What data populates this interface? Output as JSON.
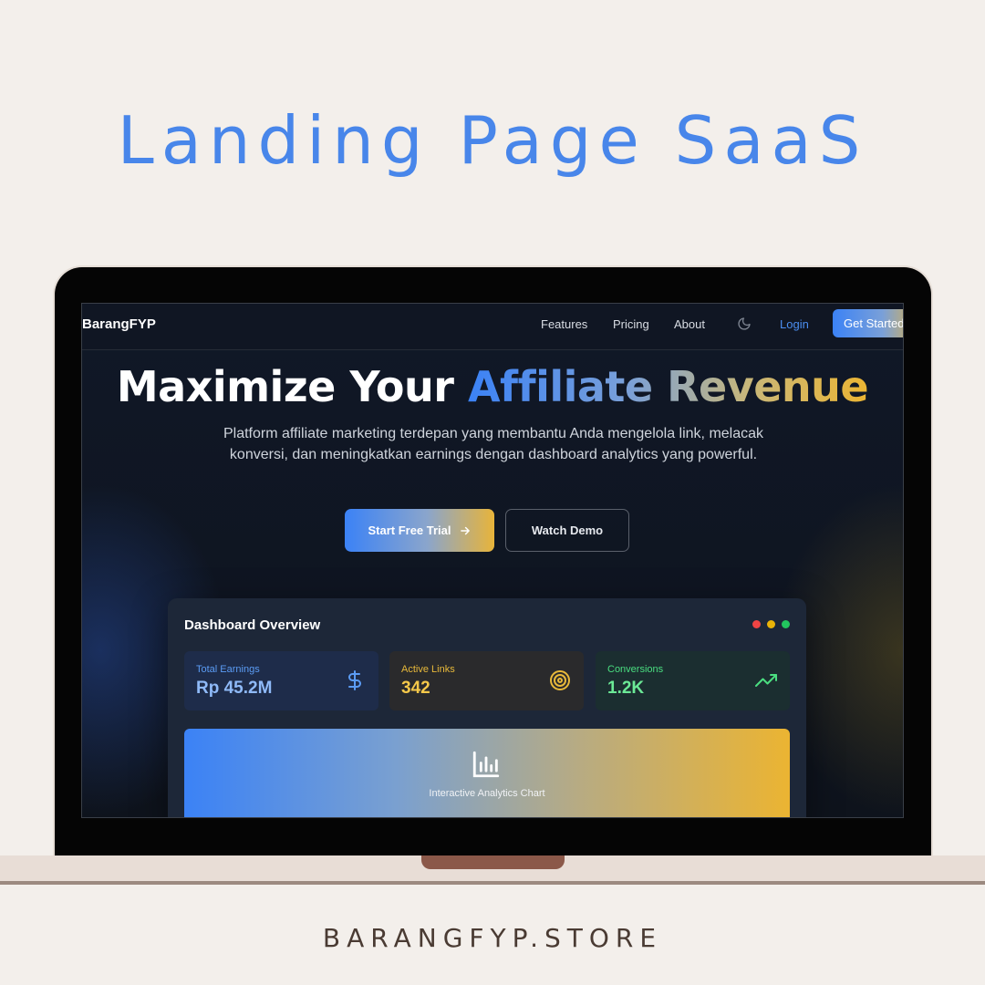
{
  "poster": {
    "title": "Landing Page SaaS",
    "footer": "BARANGFYP.STORE"
  },
  "navbar": {
    "brand": "BarangFYP",
    "links": [
      "Features",
      "Pricing",
      "About"
    ],
    "theme_icon": "moon-icon",
    "login": "Login",
    "cta": "Get Started"
  },
  "hero": {
    "title_plain": "Maximize Your ",
    "title_highlight": "Affiliate Revenue",
    "subtitle": "Platform affiliate marketing terdepan yang membantu Anda mengelola link, melacak konversi, dan meningkatkan earnings dengan dashboard analytics yang powerful.",
    "primary_button": "Start Free Trial",
    "primary_button_icon": "arrow-right-icon",
    "secondary_button": "Watch Demo"
  },
  "dashboard": {
    "title": "Dashboard Overview",
    "window_dots": [
      "#ef4444",
      "#eab308",
      "#22c55e"
    ],
    "stats": [
      {
        "label": "Total Earnings",
        "value": "Rp 45.2M",
        "icon": "dollar-icon",
        "color": "#5b9cf5"
      },
      {
        "label": "Active Links",
        "value": "342",
        "icon": "target-icon",
        "color": "#e8b93a"
      },
      {
        "label": "Conversions",
        "value": "1.2K",
        "icon": "trending-up-icon",
        "color": "#4ade80"
      }
    ],
    "chart_placeholder": "Interactive Analytics Chart",
    "chart_icon": "bar-chart-icon"
  },
  "colors": {
    "accent_blue": "#3b82f6",
    "accent_gold": "#ecb533",
    "poster_title": "#4886ea"
  }
}
